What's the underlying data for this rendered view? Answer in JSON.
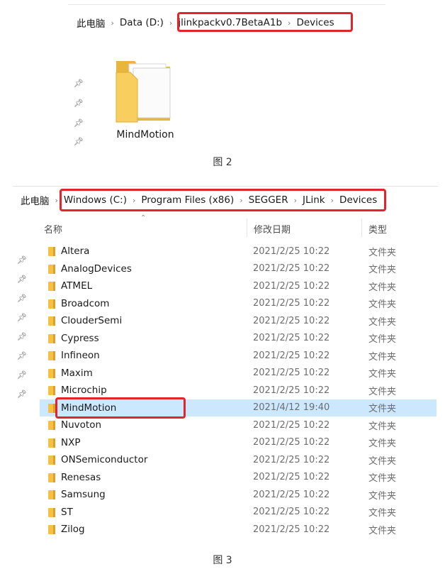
{
  "fig2": {
    "breadcrumb": [
      "此电脑",
      "Data (D:)",
      "jlinkpackv0.7BetaA1b",
      "Devices"
    ],
    "folder_label": "MindMotion",
    "caption": "图 2"
  },
  "fig3": {
    "breadcrumb": [
      "此电脑",
      "Windows (C:)",
      "Program Files (x86)",
      "SEGGER",
      "JLink",
      "Devices"
    ],
    "columns": {
      "name": "名称",
      "date": "修改日期",
      "type": "类型"
    },
    "rows": [
      {
        "name": "Altera",
        "date": "2021/2/25 10:22",
        "type": "文件夹"
      },
      {
        "name": "AnalogDevices",
        "date": "2021/2/25 10:22",
        "type": "文件夹"
      },
      {
        "name": "ATMEL",
        "date": "2021/2/25 10:22",
        "type": "文件夹"
      },
      {
        "name": "Broadcom",
        "date": "2021/2/25 10:22",
        "type": "文件夹"
      },
      {
        "name": "ClouderSemi",
        "date": "2021/2/25 10:22",
        "type": "文件夹"
      },
      {
        "name": "Cypress",
        "date": "2021/2/25 10:22",
        "type": "文件夹"
      },
      {
        "name": "Infineon",
        "date": "2021/2/25 10:22",
        "type": "文件夹"
      },
      {
        "name": "Maxim",
        "date": "2021/2/25 10:22",
        "type": "文件夹"
      },
      {
        "name": "Microchip",
        "date": "2021/2/25 10:22",
        "type": "文件夹"
      },
      {
        "name": "MindMotion",
        "date": "2021/4/12 19:40",
        "type": "文件夹",
        "selected": true
      },
      {
        "name": "Nuvoton",
        "date": "2021/2/25 10:22",
        "type": "文件夹"
      },
      {
        "name": "NXP",
        "date": "2021/2/25 10:22",
        "type": "文件夹"
      },
      {
        "name": "ONSemiconductor",
        "date": "2021/2/25 10:22",
        "type": "文件夹"
      },
      {
        "name": "Renesas",
        "date": "2021/2/25 10:22",
        "type": "文件夹"
      },
      {
        "name": "Samsung",
        "date": "2021/2/25 10:22",
        "type": "文件夹"
      },
      {
        "name": "ST",
        "date": "2021/2/25 10:22",
        "type": "文件夹"
      },
      {
        "name": "Zilog",
        "date": "2021/2/25 10:22",
        "type": "文件夹"
      }
    ],
    "caption": "图 3"
  },
  "colors": {
    "highlight": "#e3242b",
    "selection": "#cce8ff",
    "folder": "#f5c142"
  },
  "icons": {
    "folder": "folder-icon",
    "pin": "pin-icon",
    "separator": "chevron-right-icon"
  }
}
